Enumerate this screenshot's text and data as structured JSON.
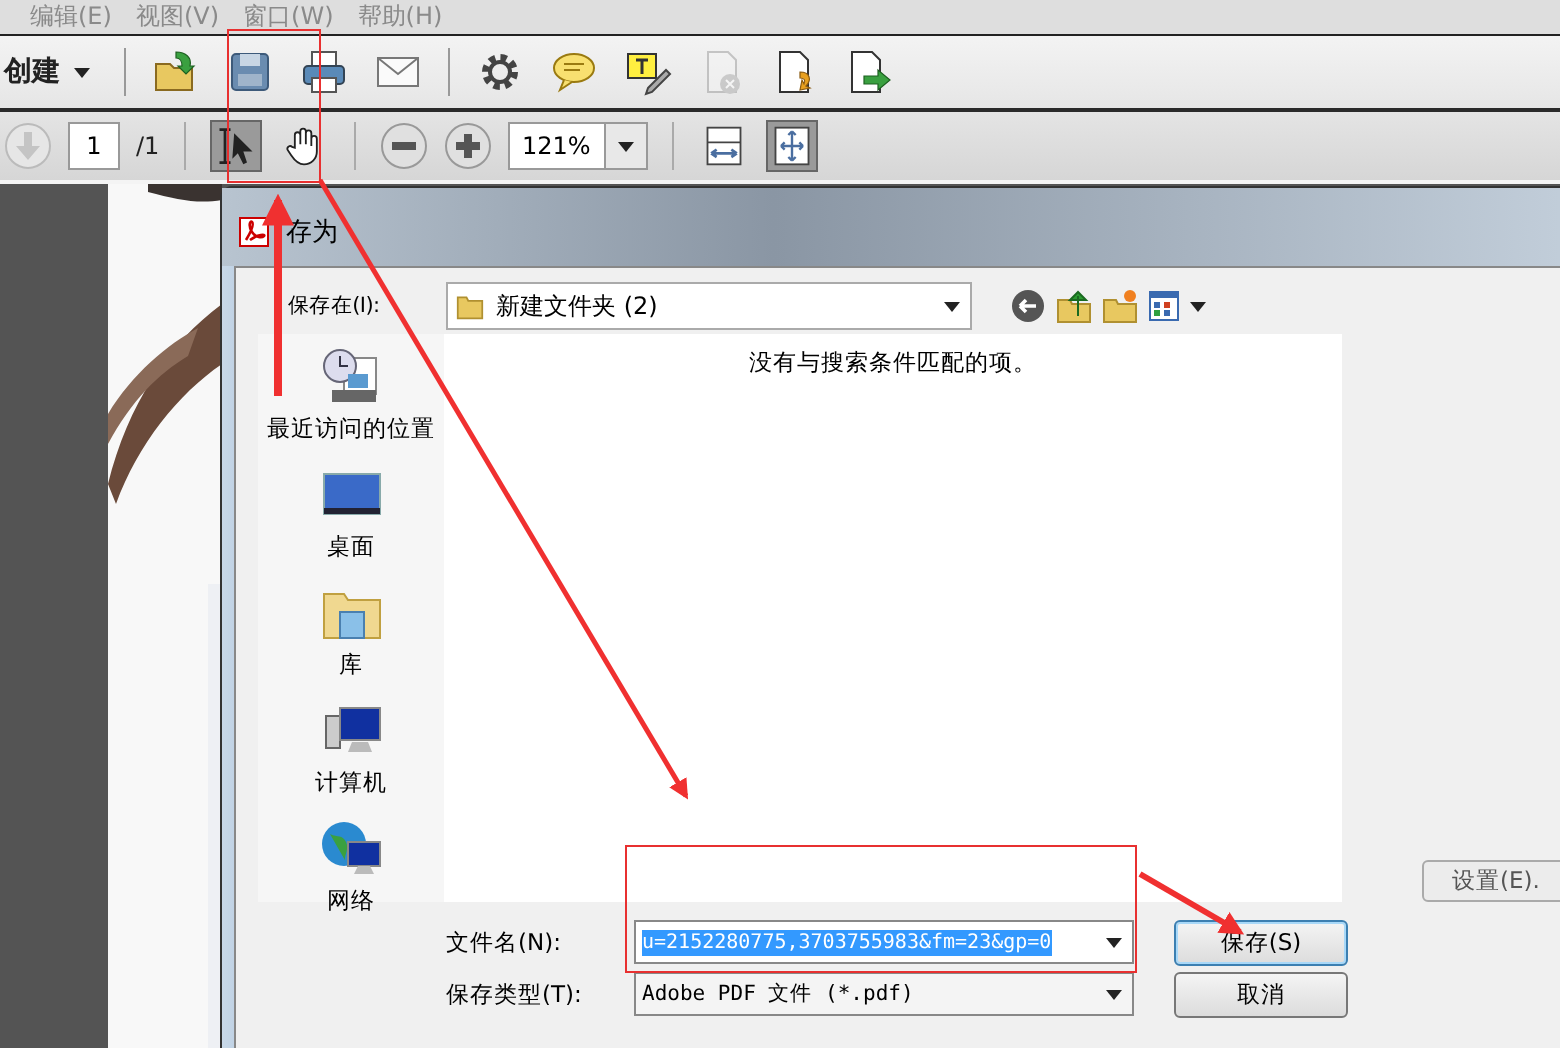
{
  "menu_bar": [
    {
      "label": "编辑(E)"
    },
    {
      "label": "视图(V)"
    },
    {
      "label": "窗口(W)"
    },
    {
      "label": "帮助(H)"
    }
  ],
  "toolbar": {
    "create_label": "创建",
    "buttons": [
      {
        "kind": "open",
        "disabled": false
      },
      {
        "kind": "save",
        "disabled": false
      },
      {
        "kind": "print",
        "disabled": false
      },
      {
        "kind": "mail",
        "disabled": false
      },
      {
        "kind": "gear",
        "disabled": false
      },
      {
        "kind": "comment",
        "disabled": false
      },
      {
        "kind": "text",
        "disabled": false
      },
      {
        "kind": "docx",
        "disabled": true
      },
      {
        "kind": "docarrow",
        "disabled": false
      },
      {
        "kind": "docexport",
        "disabled": false
      }
    ]
  },
  "nav_bar": {
    "page": "1",
    "page_total": "/1",
    "zoom": "121%",
    "tools": [
      {
        "kind": "select",
        "selected": true
      },
      {
        "kind": "hand",
        "selected": false
      }
    ],
    "views": [
      {
        "kind": "fit_width",
        "selected": false
      },
      {
        "kind": "fit_page",
        "selected": true
      }
    ]
  },
  "dialog": {
    "title": "存为",
    "save_in_label": "保存在(I):",
    "folder": "新建文件夹 (2)",
    "places": [
      {
        "kind": "recent",
        "label": "最近访问的位置"
      },
      {
        "kind": "desktop",
        "label": "桌面"
      },
      {
        "kind": "library",
        "label": "库"
      },
      {
        "kind": "computer",
        "label": "计算机"
      },
      {
        "kind": "network",
        "label": "网络"
      }
    ],
    "empty_message": "没有与搜索条件匹配的项。",
    "settings_button": "设置(E).",
    "file_name_label": "文件名(N):",
    "file_name": "u=2152280775,3703755983&fm=23&gp=0",
    "file_type_label": "保存类型(T):",
    "file_type": "Adobe PDF 文件 (*.pdf)",
    "buttons": [
      {
        "kind": "save",
        "label": "保存(S)"
      },
      {
        "kind": "cancel",
        "label": "取消"
      }
    ]
  }
}
